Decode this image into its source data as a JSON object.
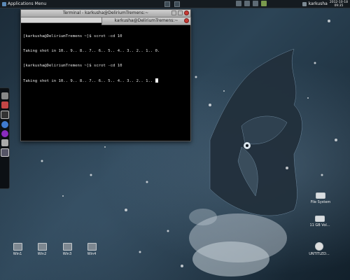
{
  "top_panel": {
    "apps_label": "Applications",
    "menu_label": "Menu",
    "username": "karkusha",
    "date": "2012-10-18",
    "time": "09:35"
  },
  "terminal_back": {
    "title": "Terminal - karkusha@DeliriumTremens:~",
    "lines": [
      "[karkusha@DeliriumTremens ~]$ scrot -cd 10",
      "Taking shot in 10.. 9.. 8.. 7.. 6.. 5.. 4.. 3.. 2.. 1.. 0.",
      "[karkusha@DeliriumTremens ~]$ scrot -cd 10",
      "Taking shot in 10.. 9.. 8.. 7.. 6.. 5.. 4.. 3.. 2.. 1.. "
    ]
  },
  "terminal_front": {
    "title": "karkusha@DeliriumTremens:~"
  },
  "desktop_icons": {
    "win1": "Win1",
    "win2": "Win2",
    "win3": "Win3",
    "win4": "Win4",
    "filesystem": "File System",
    "volume": "11 GB Vol...",
    "untitled": "UNTITLED..."
  },
  "colors": {
    "panel": "#151b20",
    "close_button": "#c83a36"
  }
}
